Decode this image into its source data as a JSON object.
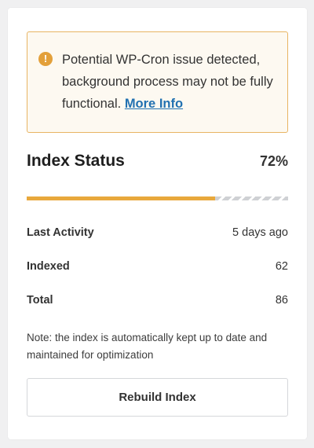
{
  "notice": {
    "icon": "exclamation-circle-icon",
    "message": "Potential WP-Cron issue detected, background process may not be fully functional.",
    "link_label": "More Info",
    "accent_color": "#e3a03a",
    "border_color": "#e8b463"
  },
  "index_status": {
    "title": "Index Status",
    "percent_label": "72%",
    "progress_fraction": 0.72,
    "progress_color": "#e8a83c"
  },
  "stats": [
    {
      "label": "Last Activity",
      "value": "5 days ago"
    },
    {
      "label": "Indexed",
      "value": "62"
    },
    {
      "label": "Total",
      "value": "86"
    }
  ],
  "note": "Note: the index is automatically kept up to date and maintained for optimization",
  "rebuild_button": {
    "label": "Rebuild Index"
  }
}
